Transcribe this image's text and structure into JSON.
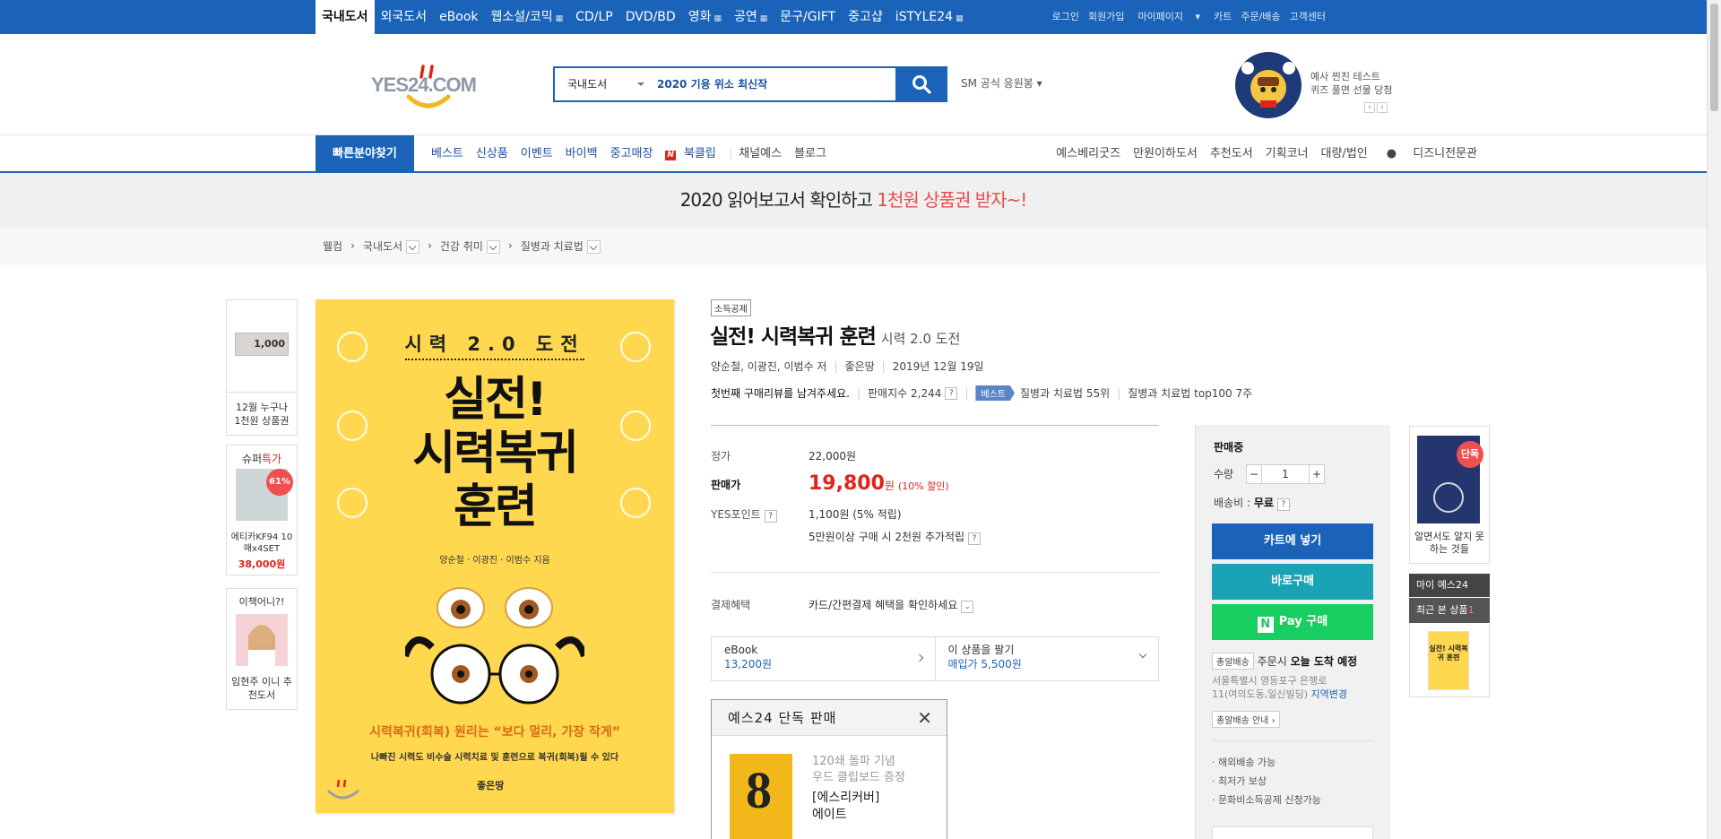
{
  "topbar": {
    "categories": [
      "국내도서",
      "외국도서",
      "eBook",
      "웹소설/코믹",
      "CD/LP",
      "DVD/BD",
      "영화",
      "공연",
      "문구/GIFT",
      "중고샵",
      "iSTYLE24"
    ],
    "util": [
      "로그인",
      "회원가입",
      "마이페이지",
      "카트",
      "주문/배송",
      "고객센터"
    ]
  },
  "header": {
    "logo": "YES24.COM",
    "search_category": "국내도서",
    "search_query": "2020 기용 위소 최신작",
    "sm_link": "SM 공식 응원봉",
    "promo_line1": "예사 찐친 테스트",
    "promo_line2": "퀴즈 풀면 선물 당첨"
  },
  "nav": {
    "quick": "빠른분야찾기",
    "menu": [
      "베스트",
      "신상품",
      "이벤트",
      "바이백",
      "중고매장",
      "북클립",
      "채널예스",
      "블로그"
    ],
    "right": [
      "예스베리굿즈",
      "만원이하도서",
      "추천도서",
      "기획코너",
      "대량/법인",
      "디즈니전문관"
    ]
  },
  "event_banner": {
    "pre": "2020 읽어보고서 확인하고 ",
    "highlight": "1천원 상품권 받자~!"
  },
  "breadcrumb": [
    "웰컴",
    "국내도서",
    "건강 취미",
    "질병과 치료법"
  ],
  "left_ads": [
    {
      "thumb": "1,000",
      "caption": "12월 누구나 1천원 상품권"
    },
    {
      "title": "슈퍼",
      "title_red": "특가",
      "discount": "61%",
      "caption": "에티카KF94 10매x4SET",
      "price": "38,000원"
    },
    {
      "title": "이책어니?!",
      "caption": "임현주 이니 추천도서"
    }
  ],
  "cover": {
    "subtitle": "시력 2.0 도전",
    "title_l1": "실전!",
    "title_l2": "시력복귀",
    "title_l3": "훈련",
    "authors": "양순철 · 이광진 · 이범수 지음",
    "slogan": "시력복귀(회복) 원리는 “보다 멀리, 가장 작게”",
    "slogan2": "나빠진 시력도 비수술 시력치료 및 훈련으로 복귀(회복)될 수 있다",
    "publisher": "좋은땅"
  },
  "product": {
    "badge": "소득공제",
    "title": "실전! 시력복귀 훈련",
    "subtitle": "시력 2.0 도전",
    "authors": "양순철, 이광진, 이범수 저",
    "publisher": "좋은땅",
    "date": "2019년 12월 19일",
    "review": "첫번째 구매리뷰를 남겨주세요.",
    "sales_index": "판매지수 2,244",
    "best_flag": "베스트",
    "rank1": "질병과 치료법 55위",
    "rank2": "질병과 치료법 top100 7주",
    "list_price_label": "정가",
    "list_price": "22,000원",
    "sale_label": "판매가",
    "sale_price": "19,800",
    "sale_unit": "원",
    "discount": "(10% 할인)",
    "point_label": "YES포인트",
    "point_value": "1,100원 (5% 적립)",
    "point_extra": "5만원이상 구매 시 2천원 추가적립",
    "pay_label": "결제혜택",
    "pay_value": "카드/간편결제 혜택을 확인하세요",
    "ebook_label": "eBook",
    "ebook_price": "13,200원",
    "resell_label": "이 상품을 팔기",
    "resell_price": "매입가 5,500원"
  },
  "exclusive": {
    "header": "예스24 단독 판매",
    "line1": "120쇄 돌파 기념",
    "line2": "우드 클립보드 증정",
    "line3": "[에스리커버]",
    "line4": "에이트"
  },
  "buybox": {
    "status": "판매중",
    "qty_label": "수량",
    "qty": "1",
    "ship_label": "배송비 :",
    "ship_value": "무료",
    "cart_btn": "카트에 넣기",
    "buy_btn": "바로구매",
    "npay_btn": "Pay 구매",
    "delivery_tag": "총알배송",
    "delivery_text": "주문시",
    "delivery_bold": "오늘 도착 예정",
    "addr1": "서울특별시 영등포구 은행로",
    "addr2": "11(여의도동,일신빌딩)",
    "addr_change": "지역변경",
    "delivery_guide": "총알배송 안내",
    "bullets": [
      "해외배송 가능",
      "최저가 보상",
      "문화비소득공제 신청가능"
    ]
  },
  "right_side": {
    "ad_tag": "단독",
    "ad_caption": "알면서도 알지 못하는 것들",
    "my_label": "마이 예스24",
    "recent_label": "최근 본 상품",
    "recent_count": "1",
    "recent_title": "실전! 시력복귀 훈련"
  }
}
